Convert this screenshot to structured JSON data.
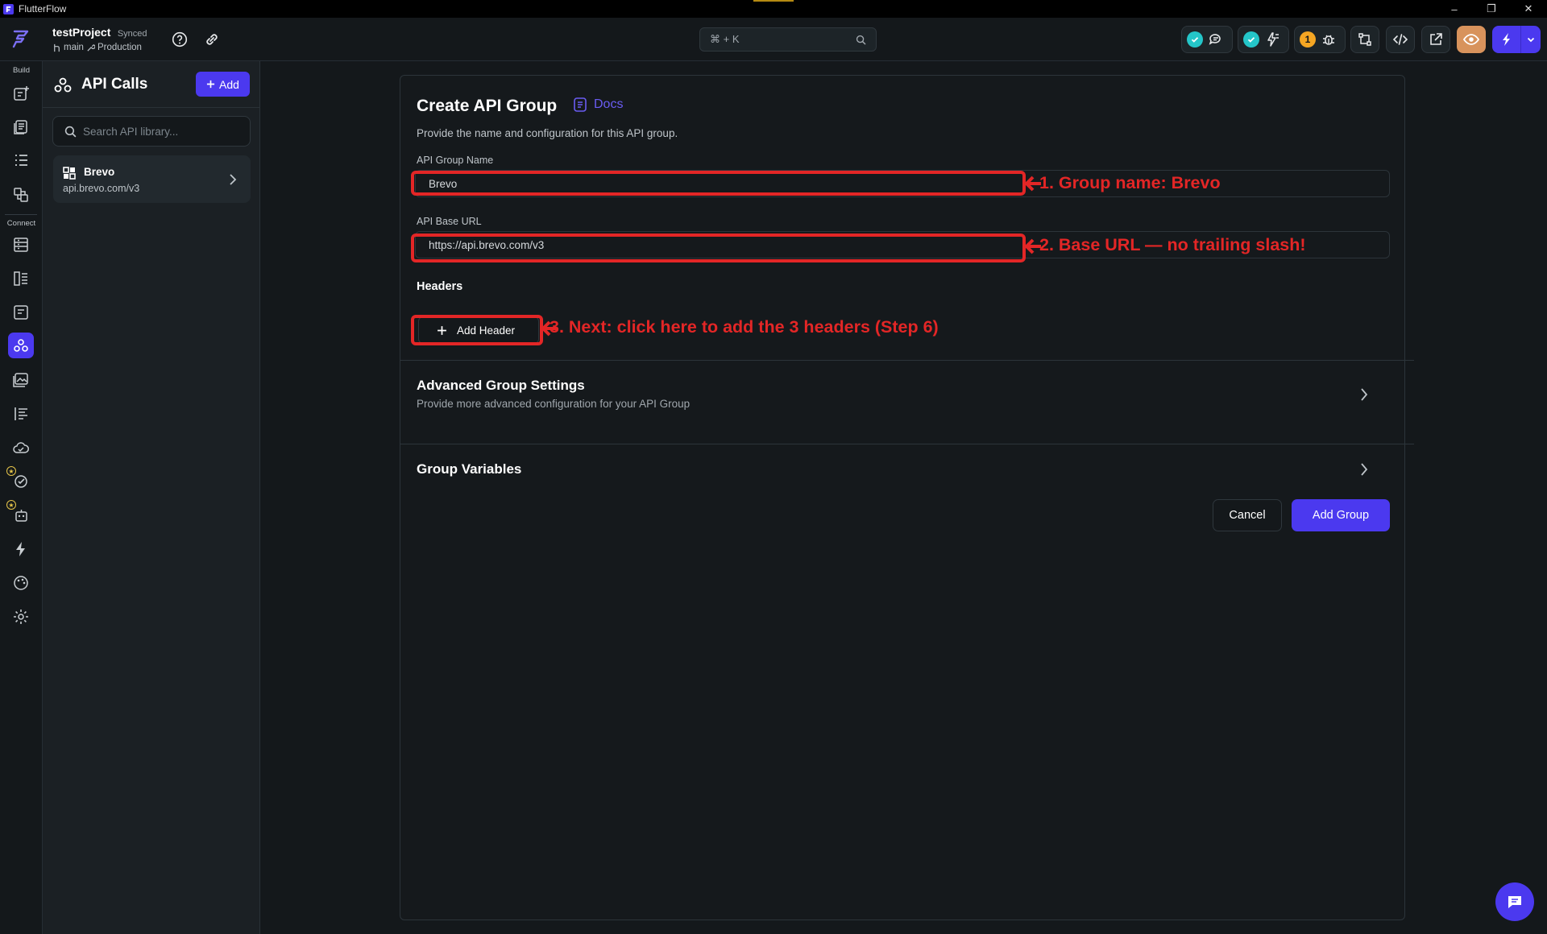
{
  "window": {
    "app_title": "FlutterFlow",
    "controls": [
      "–",
      "❐",
      "✕"
    ]
  },
  "topbar": {
    "project_name": "testProject",
    "sync_status": "Synced",
    "branch": "main",
    "environment": "Production",
    "command_search": "⌘ + K",
    "notification_count": "1"
  },
  "rail": {
    "build_label": "Build",
    "connect_label": "Connect"
  },
  "panel": {
    "title": "API Calls",
    "add_label": "Add",
    "search_placeholder": "Search API library...",
    "items": [
      {
        "name": "Brevo",
        "url": "api.brevo.com/v3"
      }
    ]
  },
  "dialog": {
    "title": "Create API Group",
    "docs_label": "Docs",
    "description": "Provide the name and configuration for this API group.",
    "group_name_label": "API Group Name",
    "group_name_value": "Brevo",
    "base_url_label": "API Base URL",
    "base_url_value": "https://api.brevo.com/v3",
    "headers_label": "Headers",
    "add_header_label": "Add Header",
    "advanced_title": "Advanced Group Settings",
    "advanced_subtitle": "Provide more advanced configuration for your API Group",
    "variables_title": "Group Variables",
    "cancel_label": "Cancel",
    "submit_label": "Add Group"
  },
  "annotations": {
    "step1": "1. Group name: Brevo",
    "step2": "2. Base URL — no trailing slash!",
    "step3": "3. Next: click here to add the 3 headers (Step 6)"
  },
  "colors": {
    "accent": "#4b39ef",
    "annotation_red": "#e32626",
    "background": "#14181b",
    "panel": "#1b2024",
    "success_check": "#24c6c9",
    "warning": "#f5a623"
  }
}
